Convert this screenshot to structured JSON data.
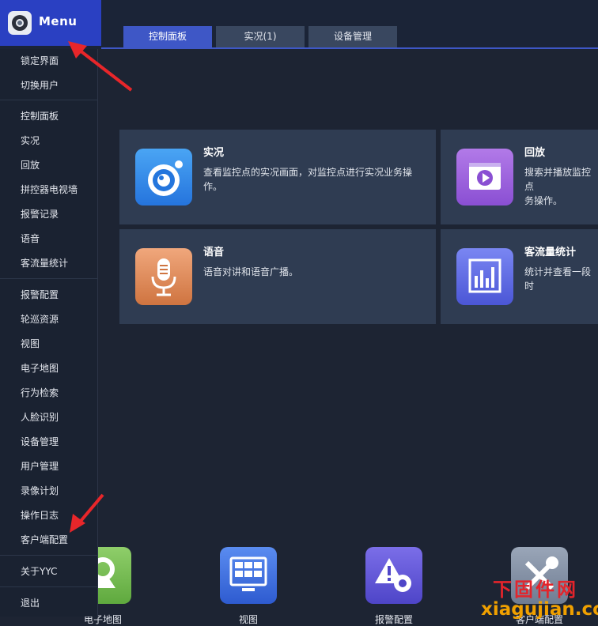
{
  "header": {
    "menu_label": "Menu",
    "tabs": [
      {
        "label": "控制面板",
        "active": true
      },
      {
        "label": "实况(1)",
        "active": false
      },
      {
        "label": "设备管理",
        "active": false
      }
    ]
  },
  "dropdown": {
    "items": [
      "锁定界面",
      "切换用户",
      "控制面板",
      "实况",
      "回放",
      "拼控器电视墙",
      "报警记录",
      "语音",
      "客流量统计",
      "报警配置",
      "轮巡资源",
      "视图",
      "电子地图",
      "行为检索",
      "人脸识别",
      "设备管理",
      "用户管理",
      "录像计划",
      "操作日志",
      "客户端配置",
      "关于YYC",
      "退出"
    ]
  },
  "cards": [
    {
      "title": "实况",
      "desc": "查看监控点的实况画面，对监控点进行实况业务操作。",
      "icon": "camera-icon"
    },
    {
      "title": "回放",
      "desc": "搜索并播放监控点",
      "desc2": "务操作。",
      "icon": "playback-icon"
    },
    {
      "title": "语音",
      "desc": "语音对讲和语音广播。",
      "icon": "microphone-icon"
    },
    {
      "title": "客流量统计",
      "desc": "统计并查看一段时",
      "icon": "bar-chart-icon"
    }
  ],
  "bottom": [
    {
      "label": "电子地图",
      "icon": "map-pin-icon"
    },
    {
      "label": "视图",
      "icon": "view-grid-icon"
    },
    {
      "label": "报警配置",
      "icon": "alarm-config-icon"
    },
    {
      "label": "客户端配置",
      "icon": "tools-icon"
    }
  ],
  "watermark": {
    "cn": "下固件网",
    "en": "xiagujian.com"
  },
  "colors": {
    "accent": "#3e57c6",
    "menu_bg": "#2a40c2",
    "card_bg": "#2f3c52",
    "annotation": "#e8262a"
  }
}
